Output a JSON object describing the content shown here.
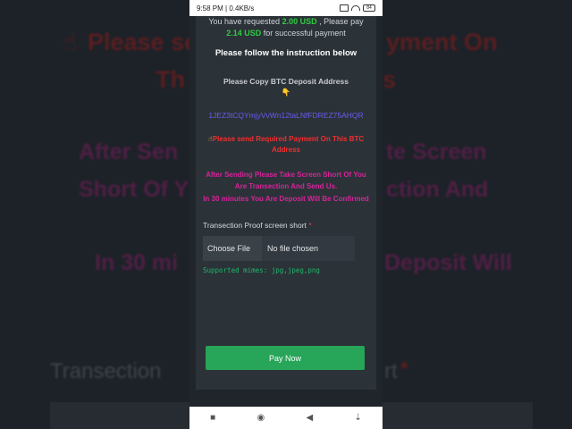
{
  "status_bar": {
    "time": "9:58 PM",
    "speed": "0.4KB/s",
    "battery": "84"
  },
  "icons": {
    "signal": "signal-bars-icon",
    "wifi": "wifi-icon",
    "battery": "battery-icon",
    "copy_hand": "pointing-down-hand-icon",
    "send_hand": "pointing-up-hand-icon",
    "nav_square": "recent-apps-icon",
    "nav_circle": "home-icon",
    "nav_triangle": "back-icon",
    "nav_down": "download-arrow-icon"
  },
  "payment": {
    "request_prefix": "You have requested",
    "requested_amount": "2.00 USD",
    "request_mid": ", Please pay",
    "pay_amount": "2.14 USD",
    "request_suffix": "for successful payment",
    "follow_instruction": "Please follow the instruction below",
    "copy_address_label": "Please Copy BTC Deposit Address",
    "btc_address": "1JEZ3tCQYmjyVvWn12taLNfFDREZ75AHQR",
    "send_required": "Please send Required Payment On This BTC Address",
    "after_sending": "After Sending Please Take Screen Short Of You Are Transection And Send Us.",
    "confirm_time": "In 30 minutes You Are Deposit Will Be Confirmed"
  },
  "form": {
    "proof_label": "Transection Proof screen short",
    "required_marker": "*",
    "choose_file_label": "Choose File",
    "no_file_text": "No file chosen",
    "supported_mimes": "Supported mimes: jpg,jpeg,png",
    "pay_button": "Pay Now"
  },
  "background": {
    "line1a": "Please se",
    "line1b": "yment On",
    "line1c": "Th",
    "line1d": "s",
    "line2a": "After Sen",
    "line2b": "te Screen",
    "line3a": "Short Of Y",
    "line3b": "ction And",
    "line4a": "In 30 mi",
    "line4b": "Deposit Will",
    "line5a": "Transection",
    "line5b": "rt"
  },
  "colors": {
    "amount_green": "#2ecc40",
    "address_purple": "#6a5cf0",
    "warning_red": "#ef2f2f",
    "instruction_magenta": "#d6249a",
    "button_green": "#27a559"
  }
}
